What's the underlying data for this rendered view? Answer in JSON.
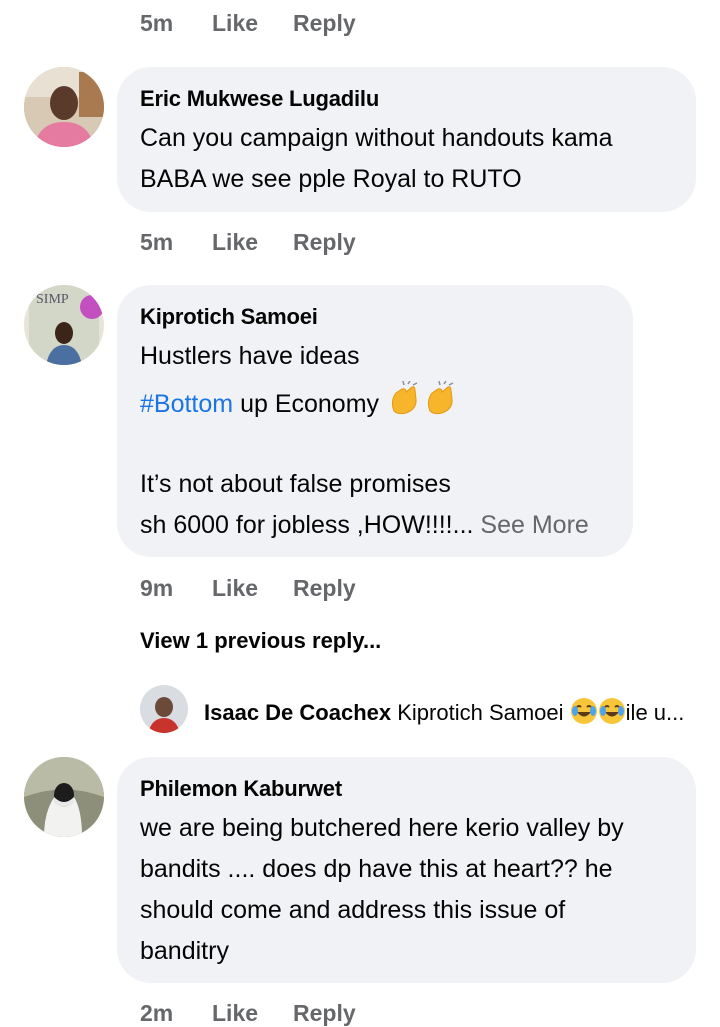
{
  "comments": [
    {
      "meta": {
        "time": "5m",
        "like": "Like",
        "reply": "Reply"
      }
    },
    {
      "author": "Eric Mukwese Lugadilu",
      "lines": [
        "Can you campaign without handouts kama",
        "BABA we see pple Royal to RUTO"
      ],
      "meta": {
        "time": "5m",
        "like": "Like",
        "reply": "Reply"
      }
    },
    {
      "author": "Kiprotich Samoei",
      "lines": [
        "Hustlers have ideas",
        "",
        "",
        "It’s not about false promises",
        "sh 6000 for jobless ,HOW!!!!..."
      ],
      "hashtag": "#Bottom",
      "hashtag_rest": "up Economy",
      "see_more": "See More",
      "meta": {
        "time": "9m",
        "like": "Like",
        "reply": "Reply"
      },
      "view_previous": "View 1 previous reply...",
      "reply_preview": {
        "author": "Isaac De Coachex",
        "mention": "Kiprotich Samoei",
        "tail": "ile u..."
      }
    },
    {
      "author": "Philemon Kaburwet",
      "lines": [
        "we are being butchered here kerio valley by",
        "bandits .... does dp have this at heart?? he",
        "should come and address this issue of",
        "banditry"
      ],
      "meta": {
        "time": "2m",
        "like": "Like",
        "reply": "Reply"
      }
    }
  ],
  "icons": {
    "clap": "clapping-hands-icon",
    "laugh": "tears-of-joy-icon"
  }
}
